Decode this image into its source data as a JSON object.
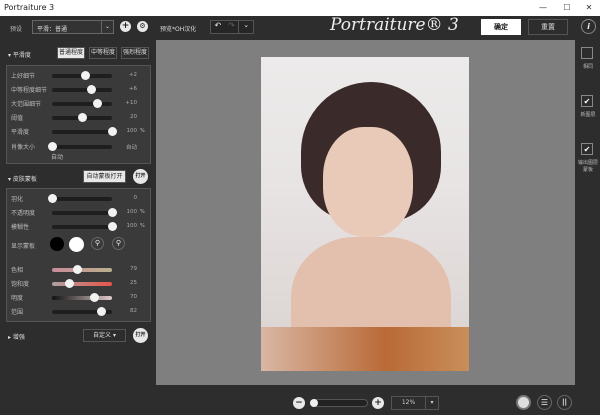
{
  "window": {
    "title": "Portraiture 3",
    "minimize": "—",
    "maximize": "☐",
    "close": "✕"
  },
  "toolbar": {
    "preset_label": "预设",
    "preset_value": "平滑：普通",
    "preview_label": "预览*OH汉化",
    "logo": "Portraiture® 3",
    "ok": "确定",
    "reset": "重置",
    "info": "i"
  },
  "smoothing": {
    "title": "平滑度",
    "modes": [
      "普通程度",
      "中等程度",
      "强烈程度"
    ],
    "active_mode": 0,
    "sliders": [
      {
        "label": "上好细节",
        "value": "+2",
        "pos": 0.55
      },
      {
        "label": "中等程度细节",
        "value": "+6",
        "pos": 0.65
      },
      {
        "label": "大范围细节",
        "value": "+10",
        "pos": 0.75
      },
      {
        "label": "阈值",
        "value": "20",
        "pos": 0.5
      },
      {
        "label": "平滑度",
        "value": "100",
        "unit": "%",
        "pos": 1.0
      },
      {
        "label": "肖像大小",
        "value": "自动",
        "pos": 0.0
      }
    ],
    "size_sub": "自动"
  },
  "skin_mask": {
    "title": "皮肤蒙板",
    "auto_btn": "自动蒙板打开",
    "toggle": "打开",
    "sliders": [
      {
        "label": "羽化",
        "value": "0",
        "pos": 0.0
      },
      {
        "label": "不透明度",
        "value": "100",
        "unit": "%",
        "pos": 1.0
      },
      {
        "label": "模糊性",
        "value": "100",
        "unit": "%",
        "pos": 1.0
      }
    ],
    "show_mask": "显示蒙板",
    "color_sliders": [
      {
        "label": "色相",
        "value": "79",
        "pos": 0.42
      },
      {
        "label": "饱和度",
        "value": "25",
        "pos": 0.28
      },
      {
        "label": "明度",
        "value": "70",
        "pos": 0.7
      },
      {
        "label": "范围",
        "value": "82",
        "pos": 0.82
      }
    ]
  },
  "enhance": {
    "title": "增强",
    "preset": "自定义",
    "toggle": "打开"
  },
  "right": {
    "items": [
      {
        "label": "相同",
        "checked": false
      },
      {
        "label": "新图层",
        "checked": true
      },
      {
        "label": "输出图层蒙板",
        "checked": true
      }
    ]
  },
  "bottom": {
    "zoom_value": "12%",
    "zoom_pos": 0.0
  }
}
